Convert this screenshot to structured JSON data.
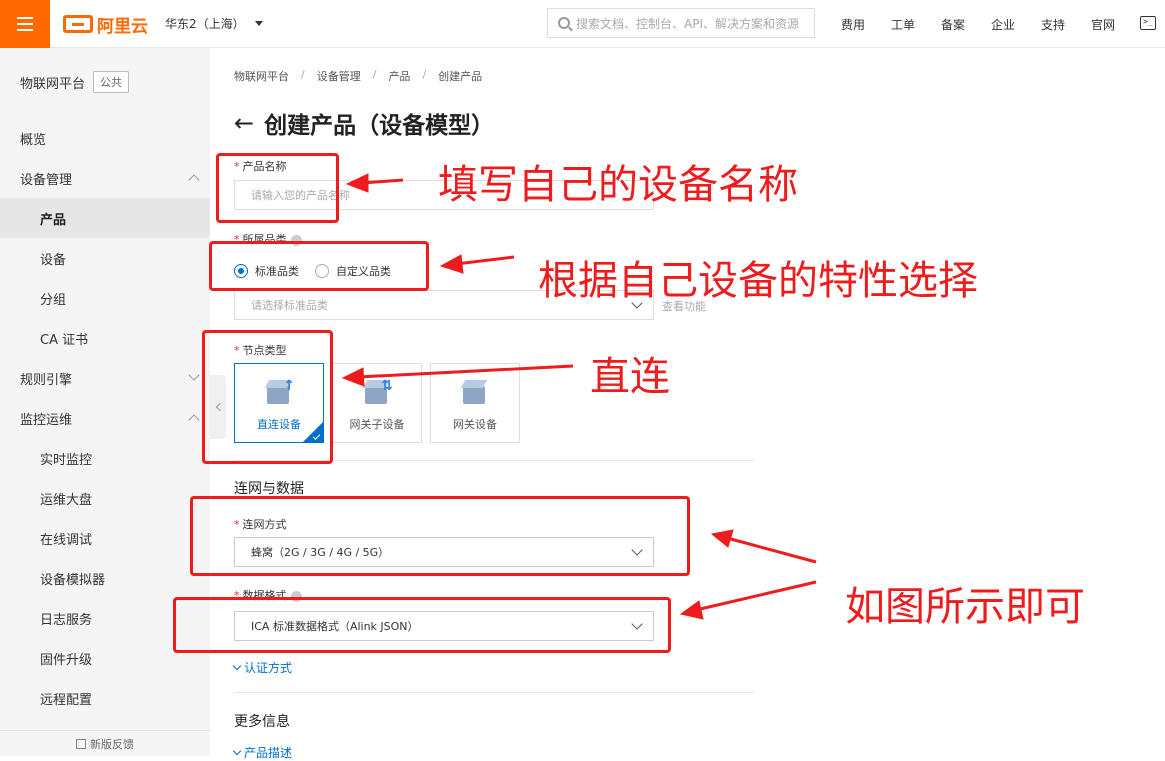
{
  "topbar": {
    "brand": "阿里云",
    "region": "华东2（上海）",
    "search_placeholder": "搜索文档、控制台、API、解决方案和资源",
    "links": [
      "费用",
      "工单",
      "备案",
      "企业",
      "支持",
      "官网"
    ],
    "terminal_glyph": ">_"
  },
  "sidebar": {
    "title": "物联网平台",
    "badge": "公共",
    "items": {
      "overview": "概览",
      "device_mgmt": "设备管理",
      "product": "产品",
      "device": "设备",
      "group": "分组",
      "ca_cert": "CA 证书",
      "rules_engine": "规则引擎",
      "monitoring": "监控运维",
      "realtime": "实时监控",
      "ops_dashboard": "运维大盘",
      "online_debug": "在线调试",
      "simulator": "设备模拟器",
      "log_service": "日志服务",
      "firmware": "固件升级",
      "remote_config": "远程配置"
    },
    "footer": "新版反馈"
  },
  "breadcrumb": [
    "物联网平台",
    "设备管理",
    "产品",
    "创建产品"
  ],
  "breadcrumb_sep": "/",
  "page_title": "创建产品（设备模型）",
  "back_glyph": "←",
  "form": {
    "product_name_label": "产品名称",
    "product_name_placeholder": "请输入您的产品名称",
    "category_label": "所属品类",
    "category_standard": "标准品类",
    "category_custom": "自定义品类",
    "category_placeholder": "请选择标准品类",
    "view_function": "查看功能",
    "node_type_label": "节点类型",
    "node_direct": "直连设备",
    "node_sub": "网关子设备",
    "node_gateway": "网关设备",
    "network_section": "连网与数据",
    "network_label": "连网方式",
    "network_value": "蜂窝（2G / 3G / 4G / 5G）",
    "data_format_label": "数据格式",
    "data_format_value": "ICA 标准数据格式（Alink JSON）",
    "auth_expander": "认证方式",
    "more_info": "更多信息",
    "product_desc": "产品描述"
  },
  "annotations": {
    "note1": "填写自己的设备名称",
    "note2": "根据自己设备的特性选择",
    "note3": "直连",
    "note4": "如图所示即可"
  },
  "colors": {
    "brand": "#ff6a00",
    "accent": "#0070cc",
    "annotation": "#ee1c1c"
  }
}
